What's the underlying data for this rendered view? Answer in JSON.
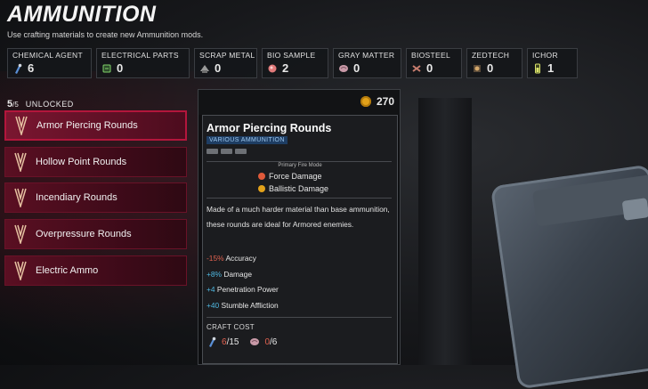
{
  "header": {
    "title": "AMMUNITION",
    "subtitle": "Use crafting materials to create new Ammunition mods."
  },
  "resources": [
    {
      "label": "CHEMICAL AGENT",
      "count": "6",
      "icon": "chemical-agent-icon",
      "color": "#5a8fd6"
    },
    {
      "label": "ELECTRICAL PARTS",
      "count": "0",
      "icon": "electrical-parts-icon",
      "color": "#7fd16a"
    },
    {
      "label": "SCRAP METAL",
      "count": "0",
      "icon": "scrap-metal-icon",
      "color": "#b9b9b9"
    },
    {
      "label": "BIO SAMPLE",
      "count": "2",
      "icon": "bio-sample-icon",
      "color": "#e07a7a"
    },
    {
      "label": "GRAY MATTER",
      "count": "0",
      "icon": "gray-matter-icon",
      "color": "#c99aa8"
    },
    {
      "label": "BIOSTEEL",
      "count": "0",
      "icon": "biosteel-icon",
      "color": "#c77d6e"
    },
    {
      "label": "ZEDTECH",
      "count": "0",
      "icon": "zedtech-icon",
      "color": "#d4a86b"
    },
    {
      "label": "ICHOR",
      "count": "1",
      "icon": "ichor-icon",
      "color": "#d9e36a"
    }
  ],
  "unlocked": {
    "count": "5",
    "total": "/5",
    "label": "UNLOCKED"
  },
  "mods": [
    {
      "label": "Armor Piercing Rounds",
      "active": true
    },
    {
      "label": "Hollow Point Rounds",
      "active": false
    },
    {
      "label": "Incendiary Rounds",
      "active": false
    },
    {
      "label": "Overpressure Rounds",
      "active": false
    },
    {
      "label": "Electric Ammo",
      "active": false
    }
  ],
  "currency": {
    "value": "270",
    "color": "#e3a21a"
  },
  "detail": {
    "name": "Armor Piercing Rounds",
    "category": "VARIOUS AMMUNITION",
    "fire_mode_label": "Primary Fire Mode",
    "damage_types": [
      {
        "label": "Force Damage",
        "color": "#e05a3a"
      },
      {
        "label": "Ballistic Damage",
        "color": "#e3a21a"
      }
    ],
    "description": "Made of a much harder material than base ammunition, these rounds are ideal for Armored enemies.",
    "stats": [
      {
        "value": "-15%",
        "label": "Accuracy",
        "color": "#e0614f"
      },
      {
        "value": "+8%",
        "label": "Damage",
        "color": "#4fb7e0"
      },
      {
        "value": "+4",
        "label": "Penetration Power",
        "color": "#4fb7e0"
      },
      {
        "value": "+40",
        "label": "Stumble Affliction",
        "color": "#4fb7e0"
      }
    ],
    "craft_cost_label": "CRAFT COST",
    "craft_cost": [
      {
        "have": "6",
        "need": "/15",
        "icon": "chemical-agent-icon",
        "color": "#e0614f"
      },
      {
        "have": "0",
        "need": "/6",
        "icon": "gray-matter-icon",
        "color": "#e0614f"
      }
    ]
  }
}
